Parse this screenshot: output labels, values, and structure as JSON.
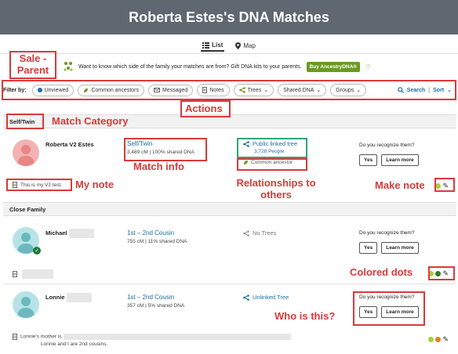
{
  "header": {
    "title": "Roberta Estes's DNA Matches"
  },
  "view_tabs": [
    {
      "label": "List",
      "icon": "list-icon"
    },
    {
      "label": "Map",
      "icon": "map-pin-icon"
    }
  ],
  "promo": {
    "text": "Want to know which side of the family your matches are from? Gift DNA kits to your parents.",
    "button": "Buy AncestryDNA®"
  },
  "filters": {
    "label": "Filter by:",
    "items": [
      "Unviewed",
      "Common ancestors",
      "Messaged",
      "Notes",
      "Trees",
      "Shared DNA",
      "Groups"
    ],
    "search": "Search",
    "sort": "Sort",
    "separator": "|"
  },
  "categories": [
    "Self/Twin",
    "Close Family"
  ],
  "matches": [
    {
      "name": "Roberta V2 Estes",
      "relationship": "Self/Twin",
      "shared": "3,489 cM | 100% shared DNA",
      "tree": "Public linked tree",
      "tree_people": "3,728 People",
      "common": "Common ancestor",
      "recognize": "Do you recognize them?",
      "yes": "Yes",
      "learn": "Learn more",
      "note": "This is my V2 test."
    },
    {
      "name": "Michael",
      "relationship": "1st – 2nd Cousin",
      "shared": "755 cM | 11% shared DNA",
      "tree": "No Trees",
      "recognize": "Do you recognize them?",
      "yes": "Yes",
      "learn": "Learn more"
    },
    {
      "name": "Lonnie",
      "relationship": "1st – 2nd Cousin",
      "shared": "357 cM | 5% shared DNA",
      "tree": "Unlinked Tree",
      "recognize": "Do you recognize them?",
      "yes": "Yes",
      "learn": "Learn more",
      "note_line1": "Lonnie's mother is",
      "note_line2": "Lonnie and I are 2nd cousins."
    }
  ],
  "annotations": {
    "sale": "Sale - Parent",
    "actions": "Actions",
    "match_category": "Match Category",
    "match_info": "Match info",
    "my_note": "My note",
    "relationships": "Relationships to others",
    "make_note": "Make note",
    "colored_dots": "Colored dots",
    "who": "Who is this?"
  },
  "colors": {
    "header": "#5f6770",
    "link": "#1a6ea8",
    "annotation": "#d93a3a",
    "buy": "#6a9a1f"
  }
}
